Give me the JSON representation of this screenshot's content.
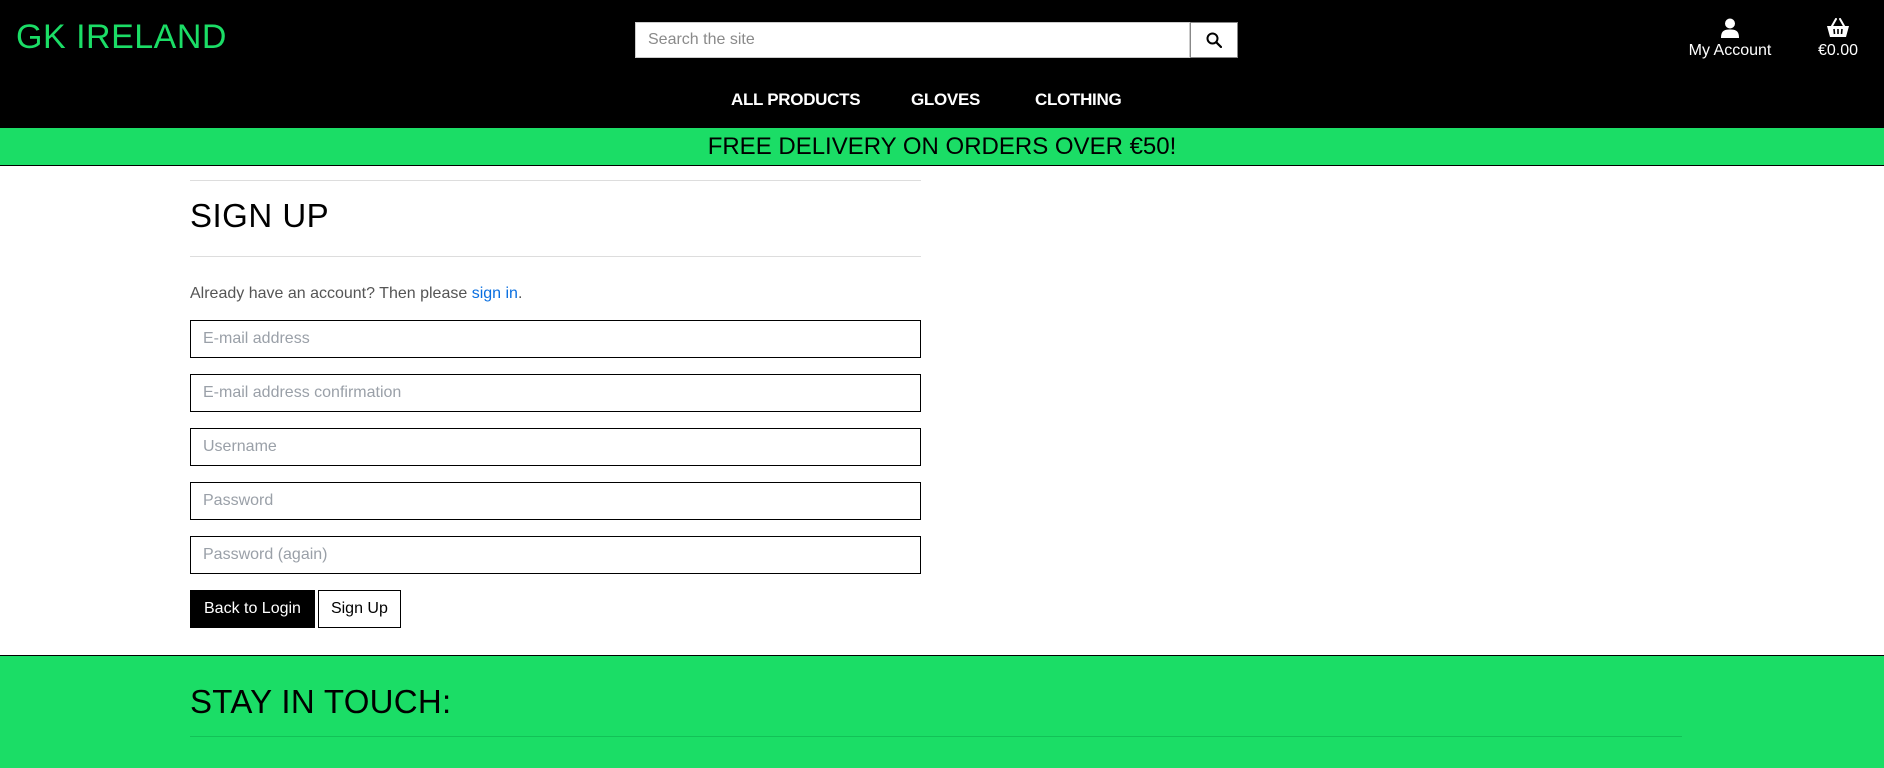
{
  "header": {
    "logo": "GK IRELAND",
    "search": {
      "placeholder": "Search the site",
      "icon": "search-icon"
    },
    "account": {
      "label": "My Account",
      "icon": "user-icon"
    },
    "cart": {
      "total": "€0.00",
      "icon": "basket-icon"
    },
    "nav": [
      "ALL PRODUCTS",
      "GLOVES",
      "CLOTHING"
    ]
  },
  "banner": {
    "text": "FREE DELIVERY ON ORDERS OVER €50!"
  },
  "signup": {
    "title": "SIGN UP",
    "intro_prefix": "Already have an account? Then please ",
    "intro_link": "sign in",
    "intro_suffix": ".",
    "fields": {
      "email": "E-mail address",
      "email_confirm": "E-mail address confirmation",
      "username": "Username",
      "password": "Password",
      "password_again": "Password (again)"
    },
    "back_button": "Back to Login",
    "signup_button": "Sign Up"
  },
  "footer": {
    "heading": "STAY IN TOUCH:"
  },
  "colors": {
    "brand_green": "#1bdd66",
    "header_bg": "#000000",
    "link_blue": "#0a6fe0"
  }
}
